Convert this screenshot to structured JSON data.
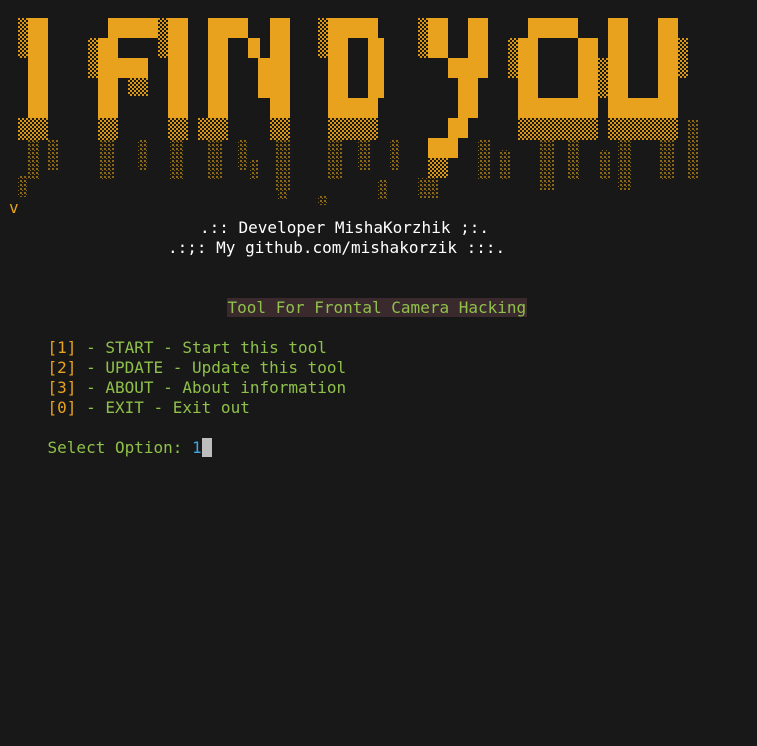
{
  "banner": {
    "title": "I FIND YOU",
    "colors": {
      "solid": "#e8a21e",
      "shade_light": "#c98a1a",
      "shade_dark": "#7a5a14"
    }
  },
  "version": "v",
  "credits": {
    "developer": ".:: Developer MishaKorzhik ;:.",
    "github": ".:;: My github.com/mishakorzik :::."
  },
  "subtitle": "Tool For Frontal Camera Hacking",
  "menu": [
    {
      "key": "[1]",
      "label": " - START - Start this tool"
    },
    {
      "key": "[2]",
      "label": " - UPDATE - Update this tool"
    },
    {
      "key": "[3]",
      "label": " - ABOUT - About information"
    },
    {
      "key": "[0]",
      "label": " - EXIT - Exit out"
    }
  ],
  "prompt": {
    "label": "Select Option: ",
    "value": "1"
  },
  "colors": {
    "background": "#181818",
    "accent_orange": "#e8a21e",
    "accent_green": "#8fc04a",
    "input_blue": "#3fa6e0",
    "text_white": "#ffffff"
  }
}
